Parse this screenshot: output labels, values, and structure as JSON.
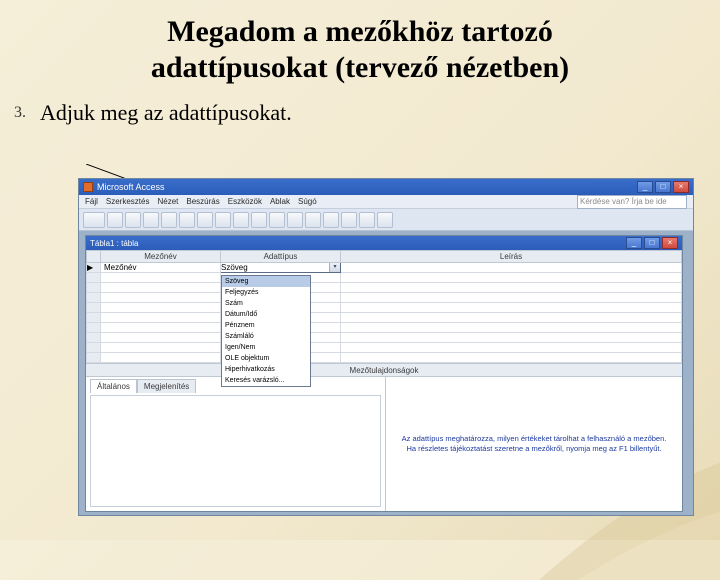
{
  "slide": {
    "title_line1": "Megadom a mezőkhöz tartozó",
    "title_line2": "adattípusokat (tervező nézetben)",
    "bullet_number": "3.",
    "bullet_text": "Adjuk meg az adattípusokat."
  },
  "app": {
    "title": "Microsoft Access",
    "search_placeholder": "Kérdése van? Írja be ide",
    "menu": [
      "Fájl",
      "Szerkesztés",
      "Nézet",
      "Beszúrás",
      "Eszközök",
      "Ablak",
      "Súgó"
    ]
  },
  "child": {
    "title": "Tábla1 : tábla"
  },
  "grid": {
    "headers": {
      "name": "Mezőnév",
      "type": "Adattípus",
      "desc": "Leírás"
    },
    "first_field": "Mezőnév",
    "selected_type": "Szöveg"
  },
  "dropdown_items": [
    "Szöveg",
    "Feljegyzés",
    "Szám",
    "Dátum/Idő",
    "Pénznem",
    "Számláló",
    "Igen/Nem",
    "OLE objektum",
    "Hiperhivatkozás",
    "Keresés varázsló..."
  ],
  "props": {
    "bar": "Mezőtulajdonságok",
    "tab_general": "Általános",
    "tab_lookup": "Megjelenítés",
    "hint": "Az adattípus meghatározza, milyen értékeket tárolhat a felhasználó a mezőben. Ha részletes tájékoztatást szeretne a mezőkről, nyomja meg az F1 billentyűt."
  }
}
